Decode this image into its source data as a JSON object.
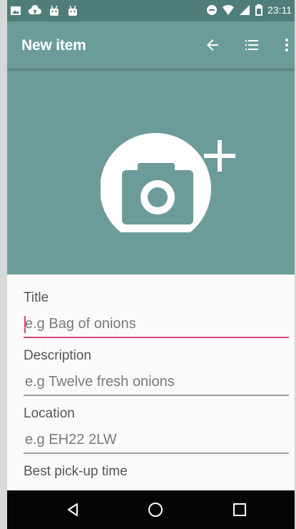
{
  "status_bar": {
    "time": "23:11",
    "left_icons": [
      "image-icon",
      "cloud-upload-icon",
      "android-icon",
      "android-icon"
    ],
    "right_icons": [
      "do-not-disturb-icon",
      "wifi-icon",
      "signal-icon",
      "battery-icon"
    ]
  },
  "app_bar": {
    "title": "New item",
    "actions": [
      "back-arrow-icon",
      "list-icon",
      "more-vert-icon"
    ]
  },
  "hero": {
    "action": "add-photo-icon"
  },
  "form": {
    "title_label": "Title",
    "title_placeholder": "e.g Bag of onions",
    "description_label": "Description",
    "description_placeholder": "e.g Twelve fresh onions",
    "location_label": "Location",
    "location_placeholder": "e.g EH22 2LW",
    "pickup_label": "Best pick-up time"
  },
  "nav_bar": {
    "buttons": [
      "back-nav-icon",
      "home-nav-icon",
      "recents-nav-icon"
    ]
  },
  "colors": {
    "status_bar": "#4f7d79",
    "app_bar": "#6c9c99",
    "accent": "#e0457b"
  }
}
